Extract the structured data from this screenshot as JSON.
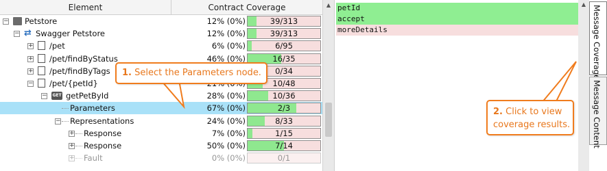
{
  "tree": {
    "headers": {
      "element": "Element",
      "coverage": "Contract Coverage"
    },
    "rows": [
      {
        "label": "Petstore",
        "pct": "12% (0%)",
        "count": "39/313",
        "ratio": 0.12,
        "icon": "folder-icon",
        "expander": "minus"
      },
      {
        "label": "Swagger Petstore",
        "pct": "12% (0%)",
        "count": "39/313",
        "ratio": 0.12,
        "icon": "swap-arrows-icon",
        "expander": "minus"
      },
      {
        "label": "/pet",
        "pct": "6% (0%)",
        "count": "6/95",
        "ratio": 0.06,
        "icon": "resource-icon",
        "expander": "plus"
      },
      {
        "label": "/pet/findByStatus",
        "pct": "46% (0%)",
        "count": "16/35",
        "ratio": 0.46,
        "icon": "resource-icon",
        "expander": "plus"
      },
      {
        "label": "/pet/findByTags",
        "pct": "0% (0%)",
        "count": "0/34",
        "ratio": 0.0,
        "icon": "resource-icon",
        "expander": "plus"
      },
      {
        "label": "/pet/{petId}",
        "pct": "21% (0%)",
        "count": "10/48",
        "ratio": 0.21,
        "icon": "resource-icon",
        "expander": "minus"
      },
      {
        "label": "getPetById",
        "pct": "28% (0%)",
        "count": "10/36",
        "ratio": 0.28,
        "icon": "get-method-icon",
        "icon_text": "GET",
        "expander": "minus"
      },
      {
        "label": "Parameters",
        "pct": "67% (0%)",
        "count": "2/3",
        "ratio": 0.67,
        "icon": "",
        "expander": "none"
      },
      {
        "label": "Representations",
        "pct": "24% (0%)",
        "count": "8/33",
        "ratio": 0.24,
        "icon": "",
        "expander": "minus"
      },
      {
        "label": "Response",
        "pct": "7% (0%)",
        "count": "1/15",
        "ratio": 0.07,
        "icon": "",
        "expander": "plus"
      },
      {
        "label": "Response",
        "pct": "50% (0%)",
        "count": "7/14",
        "ratio": 0.5,
        "icon": "",
        "expander": "plus"
      },
      {
        "label": "Fault",
        "pct": "0% (0%)",
        "count": "0/1",
        "ratio": 0.0,
        "icon": "",
        "expander": "plus"
      }
    ]
  },
  "message": {
    "lines": [
      {
        "text": "petId",
        "status": "covered"
      },
      {
        "text": "accept",
        "status": "covered"
      },
      {
        "text": "moreDetails",
        "status": "not-covered"
      }
    ]
  },
  "tabs": {
    "coverage": "Message Coverage",
    "content": "Message Content"
  },
  "callouts": {
    "one": {
      "num": "1.",
      "text": "Select the Parameters node."
    },
    "two": {
      "num": "2.",
      "line1": "Click to view",
      "line2": "coverage results."
    }
  },
  "colors": {
    "covered": "#8fe88f",
    "uncovered": "#f7dede",
    "selection": "#a9e1f8",
    "callout": "#f07c1d"
  }
}
